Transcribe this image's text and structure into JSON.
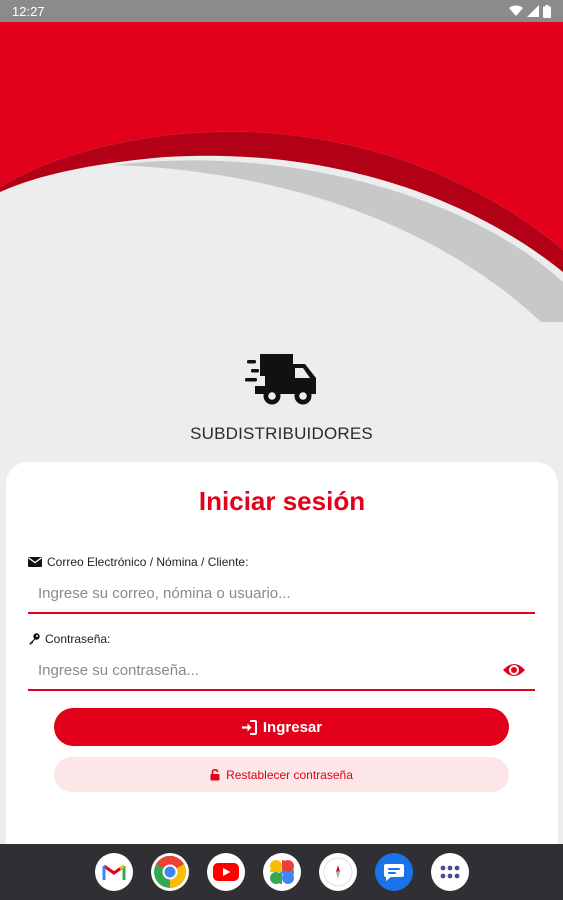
{
  "status_bar": {
    "time": "12:27"
  },
  "brand": {
    "name": "SUBDISTRIBUIDORES",
    "icon": "delivery-truck-icon"
  },
  "login": {
    "title": "Iniciar sesión",
    "user_label": "Correo Electrónico / Nómina / Cliente:",
    "user_placeholder": "Ingrese su correo, nómina o usuario...",
    "user_value": "",
    "password_label": "Contraseña:",
    "password_placeholder": "Ingrese su contraseña...",
    "password_value": "",
    "submit_label": "Ingresar",
    "reset_label": "Restablecer contraseña"
  },
  "dock": {
    "apps": [
      "gmail-icon",
      "chrome-icon",
      "youtube-icon",
      "photos-icon",
      "compass-icon",
      "messages-icon",
      "app-drawer-icon"
    ]
  },
  "colors": {
    "accent": "#e2001a",
    "accent_dark": "#b20016",
    "background": "#ededed",
    "status_bar": "#8b8b8b",
    "nav_bar": "#2f2f34",
    "secondary_button": "#fde6e8"
  }
}
